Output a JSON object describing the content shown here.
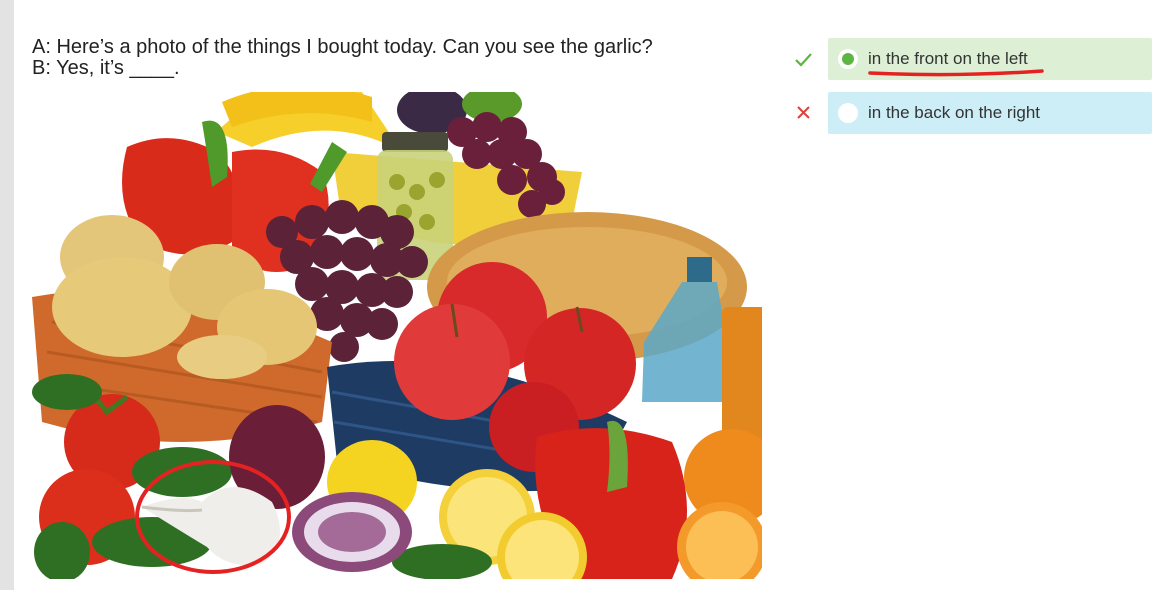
{
  "question": {
    "line_a": "A: Here’s a photo of the things I bought today. Can you see the garlic?",
    "line_b": "B: Yes, it’s ____."
  },
  "answers": [
    {
      "label": "in the front on the left",
      "status": "correct",
      "selected": true,
      "status_icon": "check-icon"
    },
    {
      "label": "in the back on the right",
      "status": "incorrect",
      "selected": false,
      "status_icon": "cross-icon"
    }
  ],
  "colors": {
    "correct_bg": "#ddf0d5",
    "incorrect_bg": "#cdeef7",
    "check": "#5db544",
    "cross": "#e0403b",
    "annotation": "#e52222"
  },
  "photo": {
    "image_type": "fruit-and-vegetables-photo",
    "annotation": "garlic-circle-annotation"
  }
}
